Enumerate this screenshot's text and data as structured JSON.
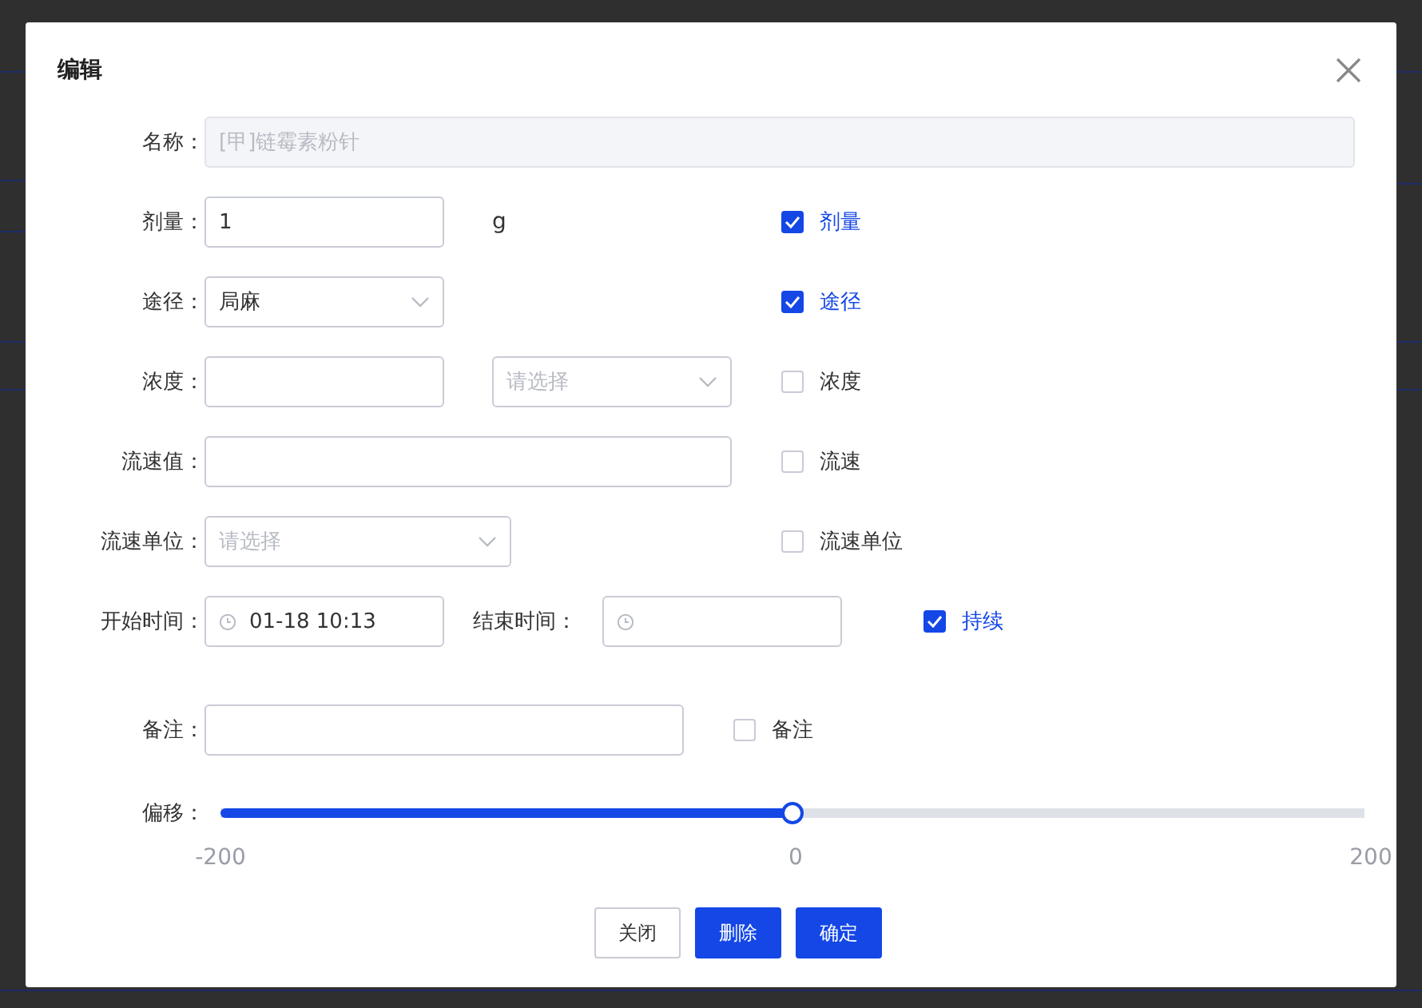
{
  "dialog": {
    "title": "编辑"
  },
  "rows": [
    {
      "label": "名称：",
      "controls": [
        {
          "kind": "input",
          "value": "[甲]链霉素粉针",
          "disabled": true
        }
      ]
    },
    {
      "label": "剂量：",
      "controls": [
        {
          "kind": "input",
          "value": "1",
          "disabled": false
        },
        {
          "kind": "unit",
          "text": "g"
        }
      ],
      "check": {
        "label": "剂量",
        "checked": true
      }
    },
    {
      "label": "途径：",
      "controls": [
        {
          "kind": "select",
          "value": "局麻"
        }
      ],
      "check": {
        "label": "途径",
        "checked": true
      }
    },
    {
      "label": "浓度：",
      "controls": [
        {
          "kind": "input",
          "disabled": false
        },
        {
          "kind": "select",
          "placeholder": "请选择"
        }
      ],
      "check": {
        "label": "浓度",
        "checked": false
      }
    },
    {
      "label": "流速值：",
      "controls": [
        {
          "kind": "input",
          "disabled": false
        }
      ],
      "check": {
        "label": "流速",
        "checked": false
      }
    },
    {
      "label": "流速单位：",
      "controls": [
        {
          "kind": "select",
          "placeholder": "请选择"
        }
      ],
      "check": {
        "label": "流速单位",
        "checked": false
      }
    },
    {
      "label": "开始时间：",
      "controls": [
        {
          "kind": "time",
          "value": "01-18 10:13"
        },
        {
          "kind": "label",
          "text": "结束时间："
        },
        {
          "kind": "time"
        }
      ],
      "check": {
        "label": "持续",
        "checked": true
      }
    },
    {
      "label": "备注：",
      "controls": [
        {
          "kind": "input",
          "disabled": false
        }
      ],
      "check": {
        "label": "备注",
        "checked": false
      }
    }
  ],
  "offset": {
    "label": "偏移：",
    "level": 0.5,
    "ticks": [
      "-200",
      "0",
      "200"
    ]
  },
  "buttons": [
    {
      "label": "关闭",
      "kind": "default"
    },
    {
      "label": "删除",
      "kind": "primary"
    },
    {
      "label": "确定",
      "kind": "primary"
    }
  ]
}
